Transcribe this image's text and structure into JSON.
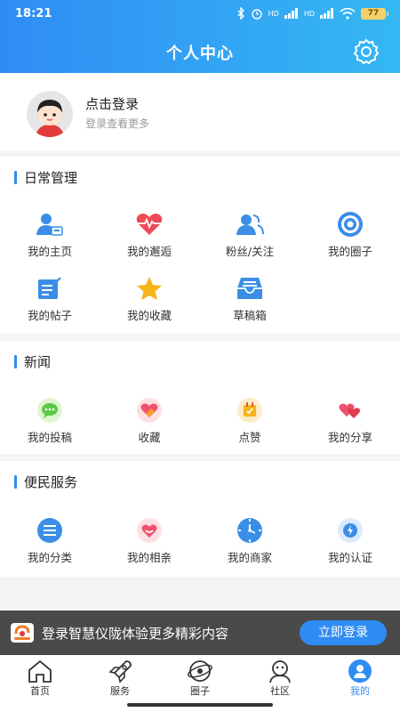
{
  "status_bar": {
    "time": "18:21",
    "battery": "77",
    "net1": "HD",
    "net2": "HD"
  },
  "header": {
    "title": "个人中心"
  },
  "profile": {
    "title": "点击登录",
    "subtitle": "登录查看更多"
  },
  "daily": {
    "title": "日常管理",
    "items": [
      {
        "label": "我的主页",
        "icon": "user-card-icon"
      },
      {
        "label": "我的邂逅",
        "icon": "heart-pulse-icon"
      },
      {
        "label": "粉丝/关注",
        "icon": "users-icon"
      },
      {
        "label": "我的圈子",
        "icon": "target-icon"
      },
      {
        "label": "我的帖子",
        "icon": "edit-doc-icon"
      },
      {
        "label": "我的收藏",
        "icon": "star-icon"
      },
      {
        "label": "草稿箱",
        "icon": "inbox-icon"
      }
    ]
  },
  "news": {
    "title": "新闻",
    "items": [
      {
        "label": "我的投稿",
        "icon": "chat-bubble-icon"
      },
      {
        "label": "收藏",
        "icon": "heart-icon"
      },
      {
        "label": "点赞",
        "icon": "thumbs-up-icon"
      },
      {
        "label": "我的分享",
        "icon": "share-hearts-icon"
      }
    ]
  },
  "service": {
    "title": "便民服务",
    "items": [
      {
        "label": "我的分类",
        "icon": "list-icon"
      },
      {
        "label": "我的相亲",
        "icon": "smile-heart-icon"
      },
      {
        "label": "我的商家",
        "icon": "clock-icon"
      },
      {
        "label": "我的认证",
        "icon": "verified-icon"
      }
    ]
  },
  "banner": {
    "text": "登录智慧仪陇体验更多精彩内容",
    "button": "立即登录"
  },
  "tabbar": {
    "tabs": [
      {
        "label": "首页",
        "icon": "home-icon"
      },
      {
        "label": "服务",
        "icon": "rocket-icon"
      },
      {
        "label": "圈子",
        "icon": "planet-icon"
      },
      {
        "label": "社区",
        "icon": "community-icon"
      },
      {
        "label": "我的",
        "icon": "profile-icon"
      }
    ],
    "active_index": 4
  },
  "colors": {
    "accent": "#2f8cf4",
    "header_start": "#2f8cf4",
    "header_end": "#35b8f3"
  }
}
